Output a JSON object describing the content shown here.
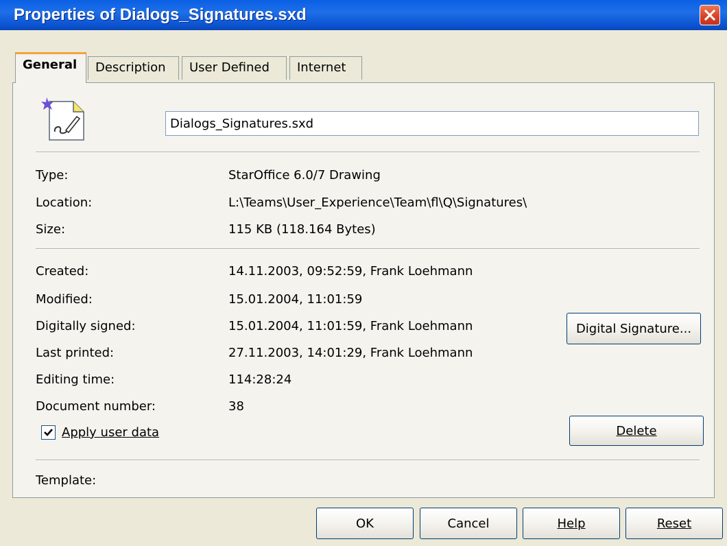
{
  "window": {
    "title": "Properties of Dialogs_Signatures.sxd"
  },
  "tabs": [
    {
      "label": "General",
      "active": true
    },
    {
      "label": "Description",
      "active": false
    },
    {
      "label": "User Defined",
      "active": false
    },
    {
      "label": "Internet",
      "active": false
    }
  ],
  "general": {
    "filename": "Dialogs_Signatures.sxd",
    "type_label": "Type:",
    "type_value": "StarOffice 6.0/7 Drawing",
    "location_label": "Location:",
    "location_value": "L:\\Teams\\User_Experience\\Team\\fl\\Q\\Signatures\\",
    "size_label": "Size:",
    "size_value": "115 KB (118.164 Bytes)",
    "created_label": "Created:",
    "created_value": "14.11.2003, 09:52:59, Frank Loehmann",
    "modified_label": "Modified:",
    "modified_value": "15.01.2004, 11:01:59",
    "signed_label": "Digitally signed:",
    "signed_value": "15.01.2004, 11:01:59, Frank Loehmann",
    "printed_label": "Last printed:",
    "printed_value": "27.11.2003, 14:01:29, Frank Loehmann",
    "editing_label": "Editing time:",
    "editing_value": "114:28:24",
    "docnum_label": "Document number:",
    "docnum_value": "38",
    "apply_user_data_label": "Apply user data",
    "apply_user_data_checked": true,
    "template_label": "Template:",
    "digital_signature_button": "Digital Signature...",
    "delete_button": "Delete"
  },
  "footer": {
    "ok": "OK",
    "cancel": "Cancel",
    "help": "Help",
    "reset": "Reset"
  },
  "icons": {
    "document": "drawing-document-icon",
    "close": "close-icon",
    "check": "check-icon"
  },
  "colors": {
    "titlebar": "#0a5fe4",
    "dialog_bg": "#ece9d8",
    "close": "#d6452a",
    "tab_accent": "#f3a33c"
  }
}
